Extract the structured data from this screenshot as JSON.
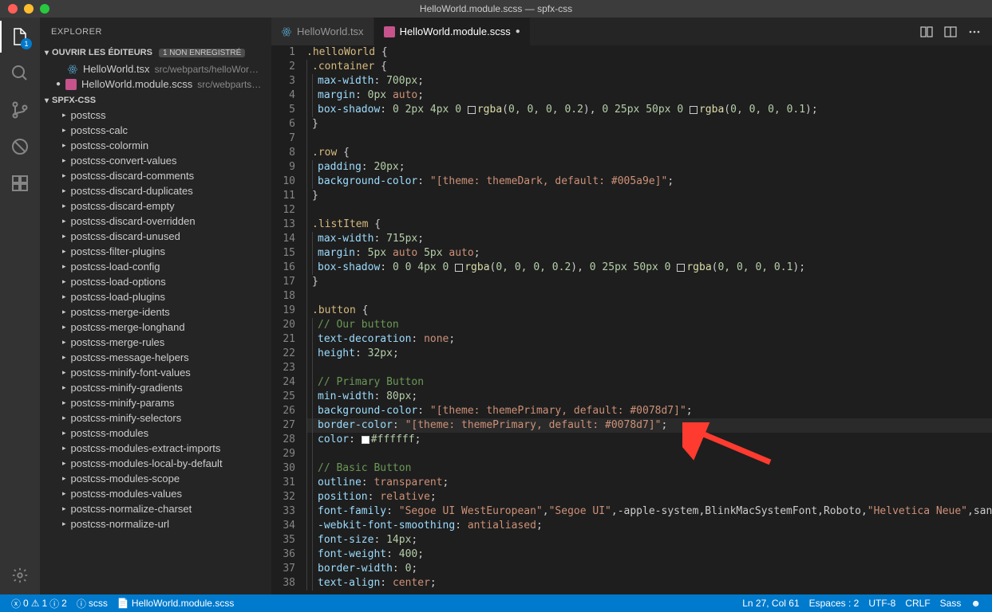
{
  "window_title": "HelloWorld.module.scss — spfx-css",
  "activity_badge": "1",
  "explorer_label": "EXPLORER",
  "open_editors_label": "OUVRIR LES ÉDITEURS",
  "open_editors_tag": "1 NON ENREGISTRÉ",
  "open_editors": [
    {
      "name": "HelloWorld.tsx",
      "path": "src/webparts/helloWor…",
      "icon": "react",
      "modified": false
    },
    {
      "name": "HelloWorld.module.scss",
      "path": "src/webparts…",
      "icon": "scss",
      "modified": true
    }
  ],
  "project_name": "SPFX-CSS",
  "tree": [
    "postcss",
    "postcss-calc",
    "postcss-colormin",
    "postcss-convert-values",
    "postcss-discard-comments",
    "postcss-discard-duplicates",
    "postcss-discard-empty",
    "postcss-discard-overridden",
    "postcss-discard-unused",
    "postcss-filter-plugins",
    "postcss-load-config",
    "postcss-load-options",
    "postcss-load-plugins",
    "postcss-merge-idents",
    "postcss-merge-longhand",
    "postcss-merge-rules",
    "postcss-message-helpers",
    "postcss-minify-font-values",
    "postcss-minify-gradients",
    "postcss-minify-params",
    "postcss-minify-selectors",
    "postcss-modules",
    "postcss-modules-extract-imports",
    "postcss-modules-local-by-default",
    "postcss-modules-scope",
    "postcss-modules-values",
    "postcss-normalize-charset",
    "postcss-normalize-url"
  ],
  "tabs": [
    {
      "name": "HelloWorld.tsx",
      "icon": "react",
      "active": false,
      "modified": false
    },
    {
      "name": "HelloWorld.module.scss",
      "icon": "scss",
      "active": true,
      "modified": true
    }
  ],
  "status": {
    "errors": "0",
    "warnings": "1",
    "info": "2",
    "lint": "scss",
    "file": "HelloWorld.module.scss",
    "cursor": "Ln 27, Col 61",
    "spaces": "Espaces : 2",
    "encoding": "UTF-8",
    "eol": "CRLF",
    "lang": "Sass"
  },
  "code": [
    {
      "n": 1,
      "h": ".helloWorld {",
      "t": [
        [
          "sel",
          ".helloWorld"
        ],
        [
          "punc",
          " {"
        ]
      ]
    },
    {
      "n": 2,
      "i": 1,
      "h": ".container {",
      "t": [
        [
          "sel",
          ".container"
        ],
        [
          "punc",
          " {"
        ]
      ]
    },
    {
      "n": 3,
      "i": 2,
      "t": [
        [
          "prop",
          "max-width"
        ],
        [
          "punc",
          ": "
        ],
        [
          "num",
          "700px"
        ],
        [
          "punc",
          ";"
        ]
      ]
    },
    {
      "n": 4,
      "i": 2,
      "t": [
        [
          "prop",
          "margin"
        ],
        [
          "punc",
          ": "
        ],
        [
          "num",
          "0px "
        ],
        [
          "val",
          "auto"
        ],
        [
          "punc",
          ";"
        ]
      ]
    },
    {
      "n": 5,
      "i": 2,
      "t": [
        [
          "prop",
          "box-shadow"
        ],
        [
          "punc",
          ": "
        ],
        [
          "num",
          "0 2px 4px 0 "
        ],
        [
          "sw",
          ""
        ],
        [
          "fn",
          "rgba"
        ],
        [
          "punc",
          "("
        ],
        [
          "num",
          "0, 0, 0, 0.2"
        ],
        [
          "punc",
          "), "
        ],
        [
          "num",
          "0 25px 50px 0 "
        ],
        [
          "sw",
          ""
        ],
        [
          "fn",
          "rgba"
        ],
        [
          "punc",
          "("
        ],
        [
          "num",
          "0, 0, 0, 0.1"
        ],
        [
          "punc",
          ");"
        ]
      ]
    },
    {
      "n": 6,
      "i": 1,
      "t": [
        [
          "punc",
          "}"
        ]
      ]
    },
    {
      "n": 7,
      "i": 1,
      "t": []
    },
    {
      "n": 8,
      "i": 1,
      "t": [
        [
          "sel",
          ".row"
        ],
        [
          "punc",
          " {"
        ]
      ]
    },
    {
      "n": 9,
      "i": 2,
      "t": [
        [
          "prop",
          "padding"
        ],
        [
          "punc",
          ": "
        ],
        [
          "num",
          "20px"
        ],
        [
          "punc",
          ";"
        ]
      ]
    },
    {
      "n": 10,
      "i": 2,
      "t": [
        [
          "prop",
          "background-color"
        ],
        [
          "punc",
          ": "
        ],
        [
          "str",
          "\"[theme: themeDark, default: #005a9e]\""
        ],
        [
          "punc",
          ";"
        ]
      ]
    },
    {
      "n": 11,
      "i": 1,
      "t": [
        [
          "punc",
          "}"
        ]
      ]
    },
    {
      "n": 12,
      "i": 1,
      "t": []
    },
    {
      "n": 13,
      "i": 1,
      "t": [
        [
          "sel",
          ".listItem"
        ],
        [
          "punc",
          " {"
        ]
      ]
    },
    {
      "n": 14,
      "i": 2,
      "t": [
        [
          "prop",
          "max-width"
        ],
        [
          "punc",
          ": "
        ],
        [
          "num",
          "715px"
        ],
        [
          "punc",
          ";"
        ]
      ]
    },
    {
      "n": 15,
      "i": 2,
      "t": [
        [
          "prop",
          "margin"
        ],
        [
          "punc",
          ": "
        ],
        [
          "num",
          "5px "
        ],
        [
          "val",
          "auto "
        ],
        [
          "num",
          "5px "
        ],
        [
          "val",
          "auto"
        ],
        [
          "punc",
          ";"
        ]
      ]
    },
    {
      "n": 16,
      "i": 2,
      "t": [
        [
          "prop",
          "box-shadow"
        ],
        [
          "punc",
          ": "
        ],
        [
          "num",
          "0 0 4px 0 "
        ],
        [
          "sw",
          ""
        ],
        [
          "fn",
          "rgba"
        ],
        [
          "punc",
          "("
        ],
        [
          "num",
          "0, 0, 0, 0.2"
        ],
        [
          "punc",
          "), "
        ],
        [
          "num",
          "0 25px 50px 0 "
        ],
        [
          "sw",
          ""
        ],
        [
          "fn",
          "rgba"
        ],
        [
          "punc",
          "("
        ],
        [
          "num",
          "0, 0, 0, 0.1"
        ],
        [
          "punc",
          ");"
        ]
      ]
    },
    {
      "n": 17,
      "i": 1,
      "t": [
        [
          "punc",
          "}"
        ]
      ]
    },
    {
      "n": 18,
      "i": 1,
      "t": []
    },
    {
      "n": 19,
      "i": 1,
      "t": [
        [
          "sel",
          ".button"
        ],
        [
          "punc",
          " {"
        ]
      ]
    },
    {
      "n": 20,
      "i": 2,
      "t": [
        [
          "com",
          "// Our button"
        ]
      ]
    },
    {
      "n": 21,
      "i": 2,
      "t": [
        [
          "prop",
          "text-decoration"
        ],
        [
          "punc",
          ": "
        ],
        [
          "val",
          "none"
        ],
        [
          "punc",
          ";"
        ]
      ]
    },
    {
      "n": 22,
      "i": 2,
      "t": [
        [
          "prop",
          "height"
        ],
        [
          "punc",
          ": "
        ],
        [
          "num",
          "32px"
        ],
        [
          "punc",
          ";"
        ]
      ]
    },
    {
      "n": 23,
      "i": 2,
      "t": []
    },
    {
      "n": 24,
      "i": 2,
      "t": [
        [
          "com",
          "// Primary Button"
        ]
      ]
    },
    {
      "n": 25,
      "i": 2,
      "t": [
        [
          "prop",
          "min-width"
        ],
        [
          "punc",
          ": "
        ],
        [
          "num",
          "80px"
        ],
        [
          "punc",
          ";"
        ]
      ]
    },
    {
      "n": 26,
      "i": 2,
      "t": [
        [
          "prop",
          "background-color"
        ],
        [
          "punc",
          ": "
        ],
        [
          "str",
          "\"[theme: themePrimary, default: #0078d7]\""
        ],
        [
          "punc",
          ";"
        ]
      ]
    },
    {
      "n": 27,
      "i": 2,
      "hl": true,
      "t": [
        [
          "prop",
          "border-color"
        ],
        [
          "punc",
          ": "
        ],
        [
          "str",
          "\"[theme: themePrimary, default: #0078d7]\""
        ],
        [
          "punc",
          ";"
        ]
      ]
    },
    {
      "n": 28,
      "i": 2,
      "t": [
        [
          "prop",
          "color"
        ],
        [
          "punc",
          ": "
        ],
        [
          "sw",
          "#fff"
        ],
        [
          "num",
          "#ffffff"
        ],
        [
          "punc",
          ";"
        ]
      ]
    },
    {
      "n": 29,
      "i": 2,
      "t": []
    },
    {
      "n": 30,
      "i": 2,
      "t": [
        [
          "com",
          "// Basic Button"
        ]
      ]
    },
    {
      "n": 31,
      "i": 2,
      "t": [
        [
          "prop",
          "outline"
        ],
        [
          "punc",
          ": "
        ],
        [
          "val",
          "transparent"
        ],
        [
          "punc",
          ";"
        ]
      ]
    },
    {
      "n": 32,
      "i": 2,
      "t": [
        [
          "prop",
          "position"
        ],
        [
          "punc",
          ": "
        ],
        [
          "val",
          "relative"
        ],
        [
          "punc",
          ";"
        ]
      ]
    },
    {
      "n": 33,
      "i": 2,
      "t": [
        [
          "prop",
          "font-family"
        ],
        [
          "punc",
          ": "
        ],
        [
          "str",
          "\"Segoe UI WestEuropean\""
        ],
        [
          "punc",
          ","
        ],
        [
          "str",
          "\"Segoe UI\""
        ],
        [
          "punc",
          ",-apple-system,BlinkMacSystemFont,Roboto,"
        ],
        [
          "str",
          "\"Helvetica Neue\""
        ],
        [
          "punc",
          ",sans-se"
        ]
      ]
    },
    {
      "n": 34,
      "i": 2,
      "t": [
        [
          "prop",
          "-webkit-font-smoothing"
        ],
        [
          "punc",
          ": "
        ],
        [
          "val",
          "antialiased"
        ],
        [
          "punc",
          ";"
        ]
      ]
    },
    {
      "n": 35,
      "i": 2,
      "t": [
        [
          "prop",
          "font-size"
        ],
        [
          "punc",
          ": "
        ],
        [
          "num",
          "14px"
        ],
        [
          "punc",
          ";"
        ]
      ]
    },
    {
      "n": 36,
      "i": 2,
      "t": [
        [
          "prop",
          "font-weight"
        ],
        [
          "punc",
          ": "
        ],
        [
          "num",
          "400"
        ],
        [
          "punc",
          ";"
        ]
      ]
    },
    {
      "n": 37,
      "i": 2,
      "t": [
        [
          "prop",
          "border-width"
        ],
        [
          "punc",
          ": "
        ],
        [
          "num",
          "0"
        ],
        [
          "punc",
          ";"
        ]
      ]
    },
    {
      "n": 38,
      "i": 2,
      "t": [
        [
          "prop",
          "text-align"
        ],
        [
          "punc",
          ": "
        ],
        [
          "val",
          "center"
        ],
        [
          "punc",
          ";"
        ]
      ]
    }
  ]
}
